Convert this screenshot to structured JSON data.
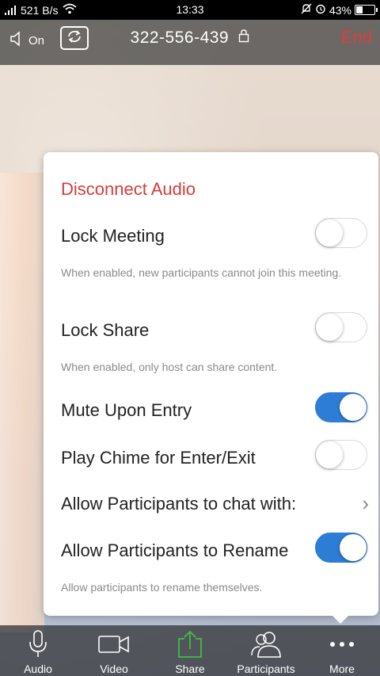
{
  "status_bar": {
    "network_speed": "521 B/s",
    "time": "13:33",
    "battery": "43%",
    "battery_level": 0.43
  },
  "meeting_bar": {
    "speaker_label": "On",
    "meeting_id": "322-556-439",
    "end_label": "End"
  },
  "popup": {
    "disconnect_audio": "Disconnect Audio",
    "lock_meeting": {
      "label": "Lock Meeting",
      "enabled": false,
      "description": "When enabled, new participants cannot join this meeting."
    },
    "lock_share": {
      "label": "Lock Share",
      "enabled": false,
      "description": "When enabled, only host can share content."
    },
    "mute_upon_entry": {
      "label": "Mute Upon Entry",
      "enabled": true
    },
    "play_chime": {
      "label": "Play Chime for Enter/Exit",
      "enabled": false
    },
    "allow_chat": {
      "label": "Allow Participants to chat with:"
    },
    "allow_rename": {
      "label": "Allow Participants to Rename",
      "enabled": true,
      "description": "Allow participants to rename themselves."
    }
  },
  "toolbar": {
    "audio": "Audio",
    "video": "Video",
    "share": "Share",
    "participants": "Participants",
    "more": "More"
  },
  "colors": {
    "accent_blue": "#2d7cd6",
    "end_red": "#e23b3b",
    "disconnect_red": "#d83b3b",
    "share_green": "#3fbf3f"
  }
}
